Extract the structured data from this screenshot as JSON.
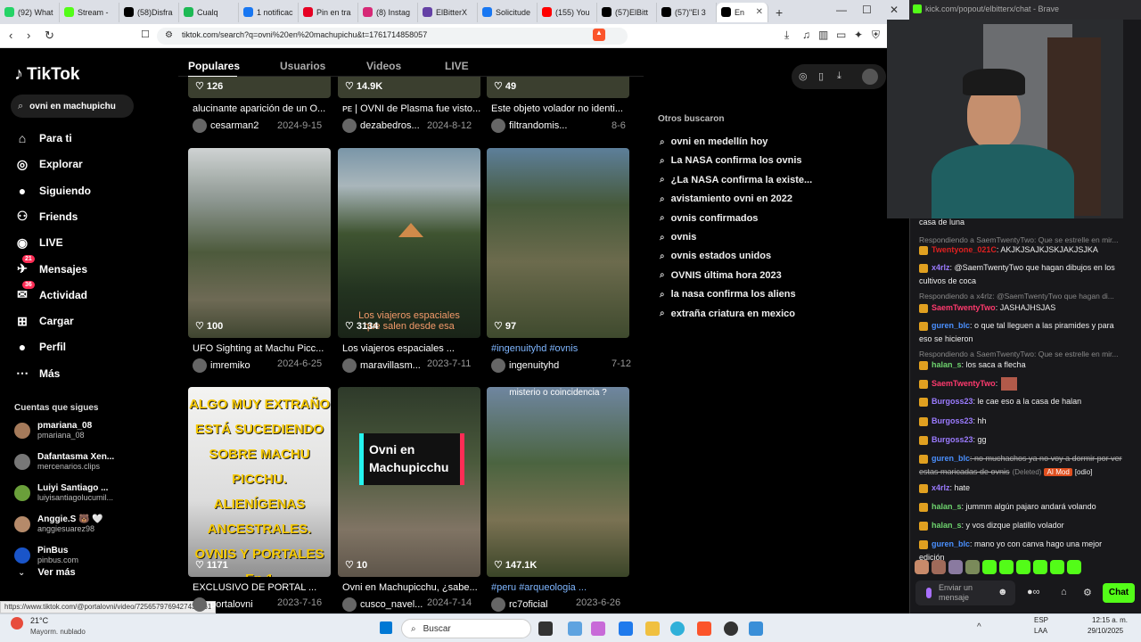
{
  "browser": {
    "tabs": [
      {
        "label": "(92) What",
        "color": "#25d366"
      },
      {
        "label": "Stream -",
        "color": "#53fc18"
      },
      {
        "label": "(58)Disfra",
        "color": "#000000"
      },
      {
        "label": "Cualq",
        "color": "#1db954"
      },
      {
        "label": "1 notificac",
        "color": "#1877f2"
      },
      {
        "label": "Pin en tra",
        "color": "#e60023"
      },
      {
        "label": "(8) Instag",
        "color": "#d62976"
      },
      {
        "label": "ElBitterX",
        "color": "#6441a5"
      },
      {
        "label": "Solicitude",
        "color": "#1877f2"
      },
      {
        "label": "(155) You",
        "color": "#ff0000"
      },
      {
        "label": "(57)ElBitt",
        "color": "#000000"
      },
      {
        "label": "(57)\"El 3",
        "color": "#000000"
      },
      {
        "label": "En",
        "color": "#000000"
      }
    ],
    "new_tab": "+",
    "url": "tiktok.com/search?q=ovni%20en%20machupichu&t=1761714858057",
    "status_url": "https://www.tiktok.com/@portalovni/video/7256579769427430661"
  },
  "right_window": {
    "title": "kick.com/popout/elbitterx/chat - Brave",
    "chat": [
      {
        "type": "msg",
        "user": "",
        "text": "casa de luna",
        "color": "#ffffff"
      },
      {
        "type": "reply",
        "text": "Respondiendo a SaemTwentyTwo: Que se estrelle en mir..."
      },
      {
        "type": "msg",
        "user": "Twentyone_021C",
        "text": ": AKJKJSAJKJSKJAKJSJKA",
        "color": "#e02020"
      },
      {
        "type": "msg",
        "user": "x4rlz",
        "text": ": @SaemTwentyTwo que hagan dibujos en los cultivos de coca",
        "color": "#9b7bff"
      },
      {
        "type": "reply",
        "text": "Respondiendo a x4rlz: @SaemTwentyTwo que hagan di..."
      },
      {
        "type": "msg",
        "user": "SaemTwentyTwo",
        "text": ": JASHAJHSJAS",
        "color": "#ff3a6e"
      },
      {
        "type": "msg",
        "user": "guren_blc",
        "text": ": o que tal lleguen a las piramides y para eso se hicieron",
        "color": "#4a90ff"
      },
      {
        "type": "reply",
        "text": "Respondiendo a SaemTwentyTwo: Que se estrelle en mir..."
      },
      {
        "type": "msg",
        "user": "halan_s",
        "text": ": los saca a flecha",
        "color": "#6dd36d"
      },
      {
        "type": "msg",
        "user": "SaemTwentyTwo",
        "text": ":",
        "color": "#ff3a6e"
      },
      {
        "type": "msg",
        "user": "Burgoss23",
        "text": ": le cae eso a la casa de halan",
        "color": "#9b7bff"
      },
      {
        "type": "msg",
        "user": "Burgoss23",
        "text": ": hh",
        "color": "#9b7bff"
      },
      {
        "type": "msg",
        "user": "Burgoss23",
        "text": ": gg",
        "color": "#9b7bff"
      },
      {
        "type": "msg",
        "user": "guren_blc",
        "text": ": no muchachos ya no voy a dormir por ver estas maricadas de ovnis",
        "color": "#4a90ff"
      },
      {
        "type": "msg",
        "user": "x4rlz",
        "text": ": hate",
        "color": "#9b7bff"
      },
      {
        "type": "msg",
        "user": "halan_s",
        "text": ": jummm algún pajaro andará volando",
        "color": "#6dd36d"
      },
      {
        "type": "msg",
        "user": "halan_s",
        "text": ": y vos dizque platillo volador",
        "color": "#6dd36d"
      },
      {
        "type": "msg",
        "user": "guren_blc",
        "text": ": mano yo con canva hago una mejor edición",
        "color": "#4a90ff"
      }
    ],
    "deleted_label": "(Deleted)",
    "ai_mod": "AI Mod",
    "odio": "[odio]",
    "chat_placeholder": "Enviar un mensaje",
    "chat_button": "Chat"
  },
  "tiktok": {
    "logo": "TikTok",
    "search_value": "ovni en machupichu",
    "nav": [
      {
        "label": "Para ti",
        "icon": "home-icon"
      },
      {
        "label": "Explorar",
        "icon": "compass-icon"
      },
      {
        "label": "Siguiendo",
        "icon": "following-icon"
      },
      {
        "label": "Friends",
        "icon": "friends-icon"
      },
      {
        "label": "LIVE",
        "icon": "live-icon"
      },
      {
        "label": "Mensajes",
        "icon": "messages-icon",
        "badge": "21"
      },
      {
        "label": "Actividad",
        "icon": "activity-icon",
        "badge": "36"
      },
      {
        "label": "Cargar",
        "icon": "upload-icon"
      },
      {
        "label": "Perfil",
        "icon": "profile-icon"
      },
      {
        "label": "Más",
        "icon": "more-icon"
      }
    ],
    "following_title": "Cuentas que sigues",
    "following": [
      {
        "name": "pmariana_08",
        "handle": "pmariana_08"
      },
      {
        "name": "Dafantasma Xen...",
        "handle": "mercenarios.clips"
      },
      {
        "name": "Luiyi Santiago ...",
        "handle": "luiyisantiagolucumil..."
      },
      {
        "name": "Anggie.S 🐻 🤍",
        "handle": "anggiesuarez98"
      },
      {
        "name": "PinBus",
        "handle": "pinbus.com"
      }
    ],
    "see_more": "Ver más",
    "search_tabs": [
      "Populares",
      "Usuarios",
      "Videos",
      "LIVE"
    ],
    "top_row": [
      {
        "likes": "126",
        "title": "alucinante aparición de un O...",
        "author": "cesarman2",
        "date": "2024-9-15"
      },
      {
        "likes": "14.9K",
        "title": "ᴘᴇ | OVNI de Plasma fue visto...",
        "author": "dezabedros...",
        "date": "2024-8-12"
      },
      {
        "likes": "49",
        "title": "Este objeto volador no identi...",
        "author": "filtrandomis...",
        "date": "8-6"
      }
    ],
    "videos": [
      {
        "likes": "100",
        "title": "UFO Sighting at Machu Picc...",
        "author": "imremiko",
        "date": "2024-6-25",
        "overlay": ""
      },
      {
        "likes": "3134",
        "title": "Los viajeros espaciales ...",
        "author": "maravillasm...",
        "date": "2023-7-11",
        "overlay": "Los viajeros espaciales que salen desde esa"
      },
      {
        "likes": "97",
        "title": "#ingenuityhd #ovnis",
        "author": "ingenuityhd",
        "date": "7-12",
        "overlay": ""
      },
      {
        "likes": "1171",
        "title": "EXCLUSIVO DE PORTAL ...",
        "author": "portalovni",
        "date": "2023-7-16",
        "overlay": "ALGO MUY EXTRAÑO ESTÁ SUCEDIENDO SOBRE MACHU PICCHU. ALIENÍGENAS ANCESTRALES. OVNIS Y PORTALES Ep.1"
      },
      {
        "likes": "10",
        "title": "Ovni en Machupicchu, ¿sabe...",
        "author": "cusco_navel...",
        "date": "2024-7-14",
        "overlay": "Ovni en Machupicchu"
      },
      {
        "likes": "147.1K",
        "title": "#peru #arqueologia ...",
        "author": "rc7oficial",
        "date": "2023-6-26",
        "overlay": "misterio o coincidencia ?"
      }
    ],
    "others_title": "Otros buscaron",
    "suggestions": [
      "ovni en medellín hoy",
      "La NASA confirma los ovnis",
      "¿La NASA confirma la existe...",
      "avistamiento ovni en 2022",
      "ovnis confirmados",
      "ovnis",
      "ovnis estados unidos",
      "OVNIS última hora 2023",
      "la nasa confirma los aliens",
      "extraña criatura en mexico"
    ]
  },
  "taskbar": {
    "weather_temp": "21°C",
    "weather_desc": "Mayorm. nublado",
    "search": "Buscar",
    "lang1": "ESP",
    "lang2": "LAA",
    "time": "12:15 a. m.",
    "date": "29/10/2025"
  }
}
